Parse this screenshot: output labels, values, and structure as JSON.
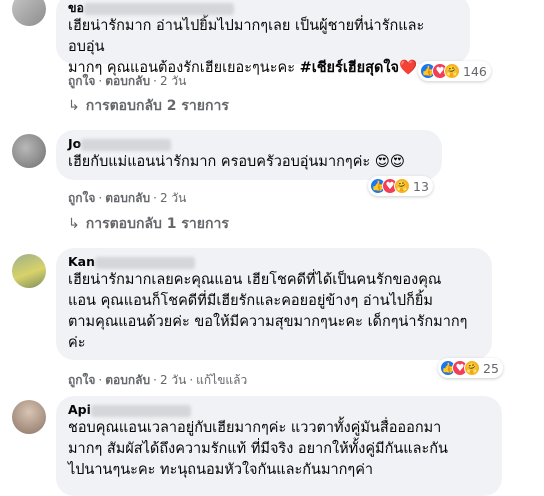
{
  "comments": [
    {
      "author": "ขอ",
      "text_lines": [
        "เฮียน่ารักมาก อ่านไปยิ้มไปมากๆเลย เป็นผู้ชายที่น่ารักและอบอุ่น"
      ],
      "text_last": "มากๆ คุณแอนต้องรักเฮียเยอะๆนะคะ ",
      "hashtag": "#เชียร์เฮียสุดใจ",
      "emoji_end": "❤️",
      "like_label": "ถูกใจ",
      "reply_label": "ตอบกลับ",
      "time": "2 วัน",
      "reaction_count": "146",
      "replies_label": "การตอบกลับ 2 รายการ"
    },
    {
      "author": "Jo",
      "text": "เฮียกับแม่แอนน่ารักมาก ครอบครัวอบอุ่นมากๆค่ะ 😍😍",
      "like_label": "ถูกใจ",
      "reply_label": "ตอบกลับ",
      "time": "2 วัน",
      "reaction_count": "13",
      "replies_label": "การตอบกลับ 1 รายการ"
    },
    {
      "author": "Kan",
      "text_lines": [
        "เฮียน่ารักมากเลยคะคุณแอน เฮียโชคดีที่ได้เป็นคนรักของคุณ",
        "แอน คุณแอนก็โชคดีที่มีเฮียรักและคอยอยู่ข้างๆ อ่านไปก็ยิ้ม",
        "ตามคุณแอนด้วยค่ะ ขอให้มีความสุขมากๆนะคะ เด็กๆน่ารักมากๆ",
        "ค่ะ"
      ],
      "like_label": "ถูกใจ",
      "reply_label": "ตอบกลับ",
      "time": "2 วัน",
      "edited_label": "แก้ไขแล้ว",
      "reaction_count": "25"
    },
    {
      "author": "Api",
      "text_lines": [
        "ชอบคุณแอนเวลาอยู่กับเฮียมากๆค่ะ แววตาทั้งคู่มันสื่อออกมา",
        "มากๆ สัมผัสได้ถึงความรักแท้ ที่มีจริง อยากให้ทั้งคู่มีกันและกัน",
        "ไปนานๆนะคะ ทะนุถนอมหัวใจกันและกันมากๆค่า"
      ]
    }
  ],
  "reaction_icons": [
    "like-icon",
    "love-icon",
    "care-icon"
  ],
  "colors": {
    "bubble": "#f0f2f5",
    "meta": "#65676b",
    "like": "#1877f2",
    "love": "#f33e58"
  }
}
